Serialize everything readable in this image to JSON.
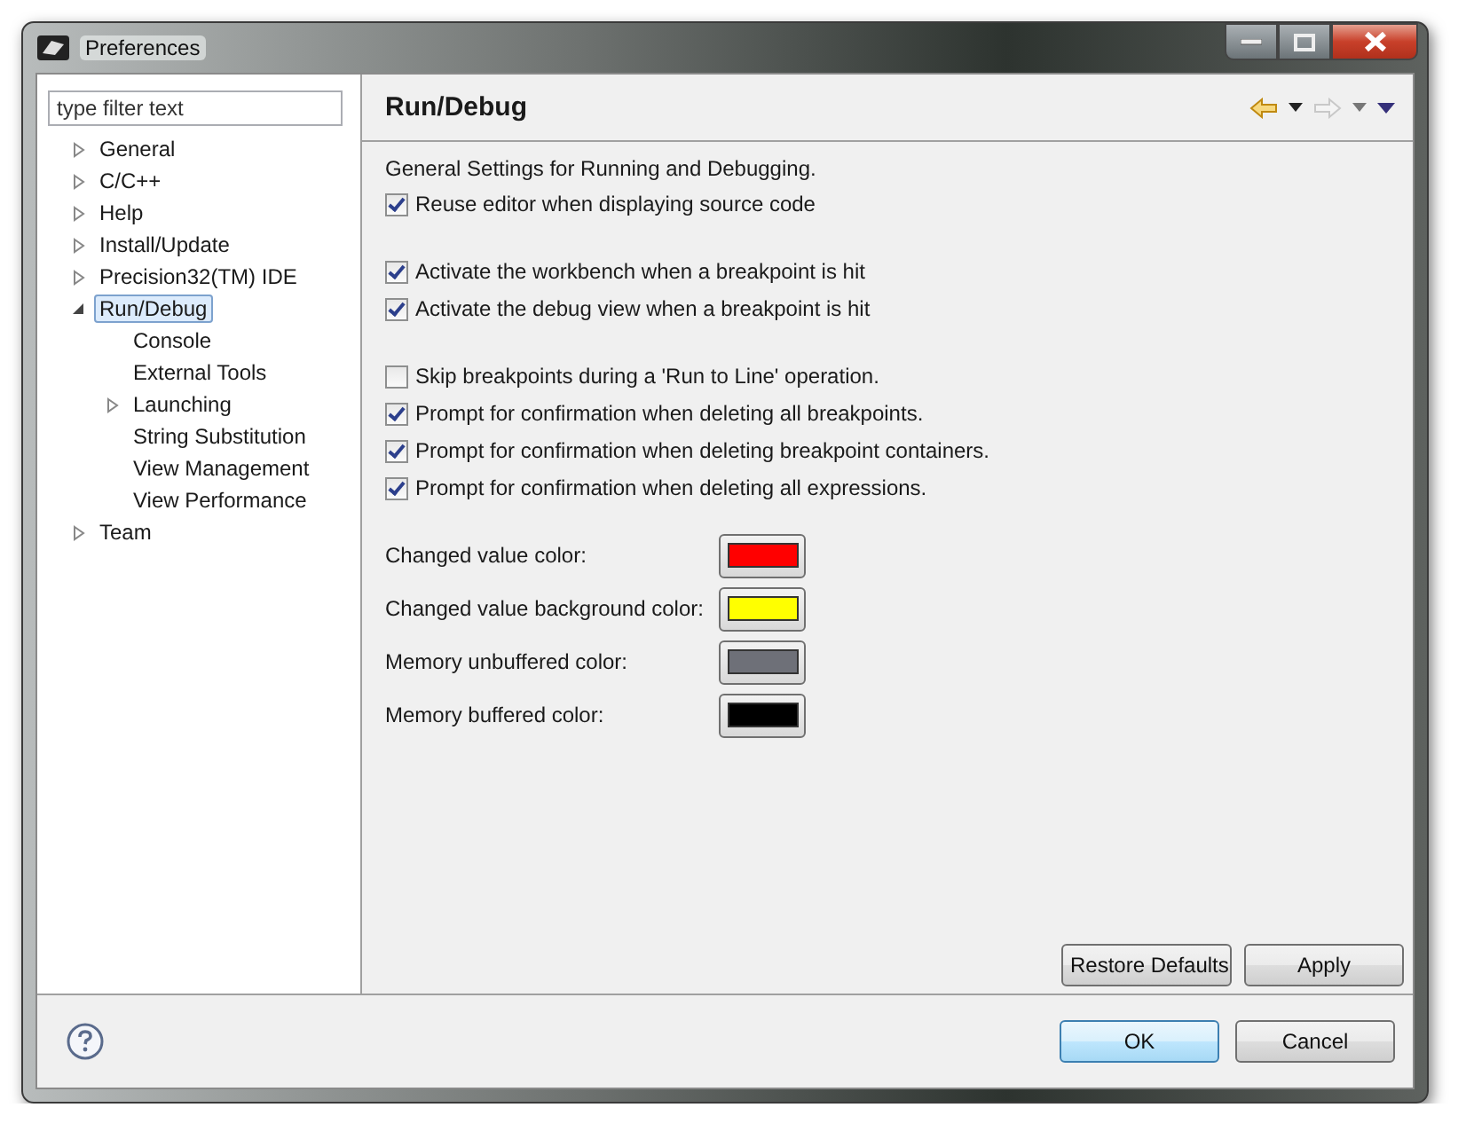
{
  "window": {
    "title": "Preferences"
  },
  "filter": {
    "placeholder": "type filter text"
  },
  "tree": [
    {
      "label": "General",
      "expanded": false,
      "selected": false
    },
    {
      "label": "C/C++",
      "expanded": false,
      "selected": false
    },
    {
      "label": "Help",
      "expanded": false,
      "selected": false
    },
    {
      "label": "Install/Update",
      "expanded": false,
      "selected": false
    },
    {
      "label": "Precision32(TM) IDE",
      "expanded": false,
      "selected": false
    },
    {
      "label": "Run/Debug",
      "expanded": true,
      "selected": true,
      "children": [
        {
          "label": "Console",
          "selected": false
        },
        {
          "label": "External Tools",
          "selected": false
        },
        {
          "label": "Launching",
          "expanded": false,
          "selected": false
        },
        {
          "label": "String Substitution",
          "selected": false
        },
        {
          "label": "View Management",
          "selected": false
        },
        {
          "label": "View Performance",
          "selected": false
        }
      ]
    },
    {
      "label": "Team",
      "expanded": false,
      "selected": false
    }
  ],
  "page": {
    "title": "Run/Debug",
    "description": "General Settings for Running and Debugging."
  },
  "checkbox_groups": [
    [
      {
        "label": "Reuse editor when displaying source code",
        "checked": true
      }
    ],
    [
      {
        "label": "Activate the workbench when a breakpoint is hit",
        "checked": true
      },
      {
        "label": "Activate the debug view when a breakpoint is hit",
        "checked": true
      }
    ],
    [
      {
        "label": "Skip breakpoints during a 'Run to Line' operation.",
        "checked": false
      },
      {
        "label": "Prompt for confirmation when deleting all breakpoints.",
        "checked": true
      },
      {
        "label": "Prompt for confirmation when deleting breakpoint containers.",
        "checked": true
      },
      {
        "label": "Prompt for confirmation when deleting all expressions.",
        "checked": true
      }
    ]
  ],
  "colors": [
    {
      "label": "Changed value color:",
      "color": "#ff0000"
    },
    {
      "label": "Changed value background color:",
      "color": "#ffff00"
    },
    {
      "label": "Memory unbuffered color:",
      "color": "#6e7078"
    },
    {
      "label": "Memory buffered color:",
      "color": "#000000"
    }
  ],
  "page_buttons": [
    "Restore Defaults",
    "Apply"
  ],
  "dialog_buttons": [
    {
      "label": "OK",
      "default": true
    },
    {
      "label": "Cancel",
      "default": false
    }
  ]
}
